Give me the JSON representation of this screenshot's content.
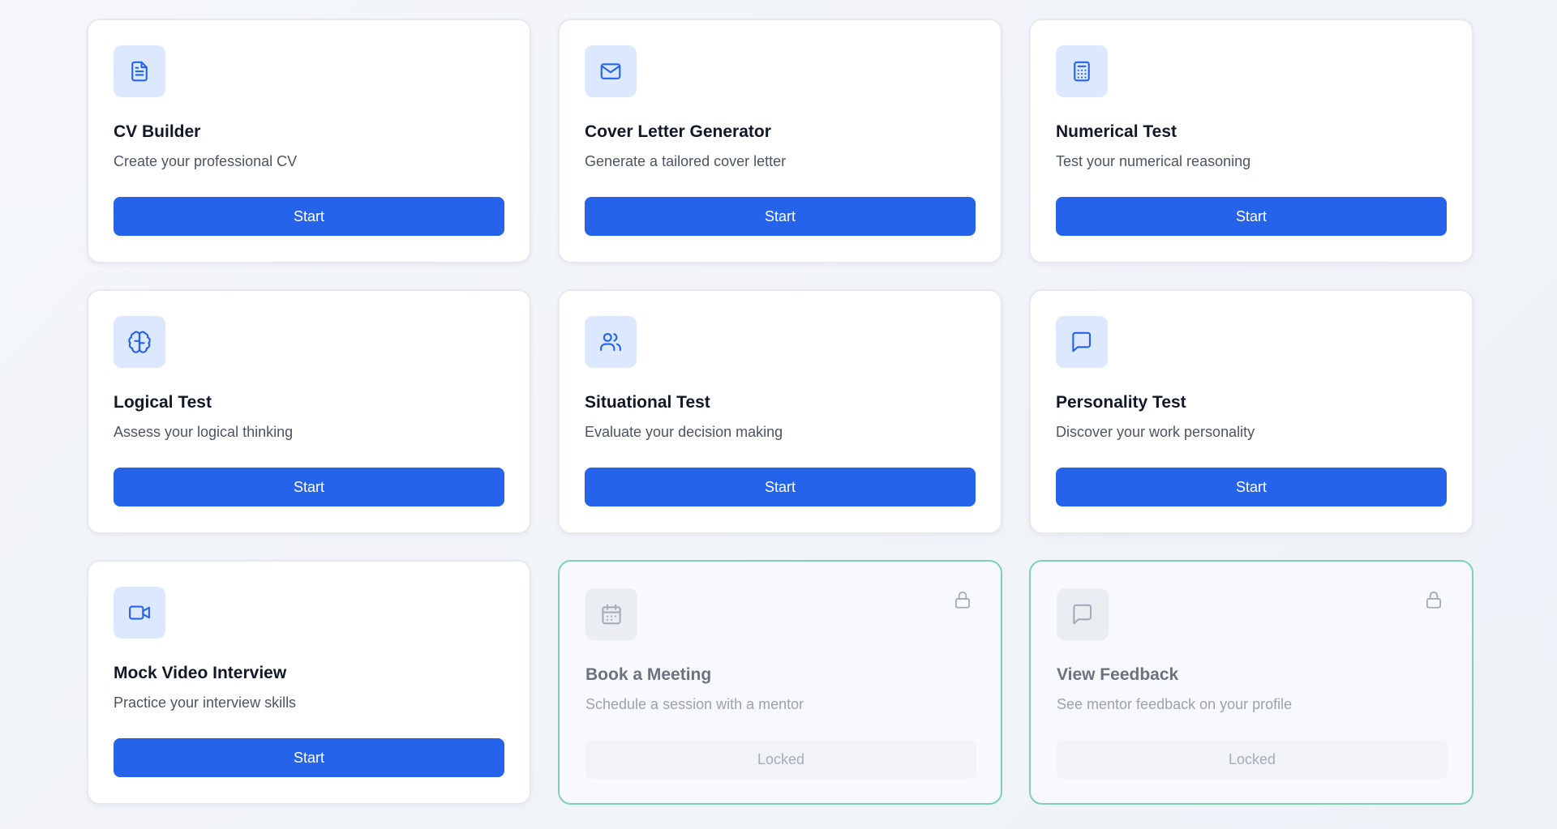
{
  "cards": [
    {
      "title": "CV Builder",
      "subtitle": "Create your professional CV",
      "button": "Start",
      "icon": "document-icon",
      "locked": false
    },
    {
      "title": "Cover Letter Generator",
      "subtitle": "Generate a tailored cover letter",
      "button": "Start",
      "icon": "envelope-icon",
      "locked": false
    },
    {
      "title": "Numerical Test",
      "subtitle": "Test your numerical reasoning",
      "button": "Start",
      "icon": "calculator-icon",
      "locked": false
    },
    {
      "title": "Logical Test",
      "subtitle": "Assess your logical thinking",
      "button": "Start",
      "icon": "brain-icon",
      "locked": false
    },
    {
      "title": "Situational Test",
      "subtitle": "Evaluate your decision making",
      "button": "Start",
      "icon": "users-icon",
      "locked": false
    },
    {
      "title": "Personality Test",
      "subtitle": "Discover your work personality",
      "button": "Start",
      "icon": "chat-icon",
      "locked": false
    },
    {
      "title": "Mock Video Interview",
      "subtitle": "Practice your interview skills",
      "button": "Start",
      "icon": "video-camera-icon",
      "locked": false
    },
    {
      "title": "Book a Meeting",
      "subtitle": "Schedule a session with a mentor",
      "button": "Locked",
      "icon": "calendar-icon",
      "locked": true
    },
    {
      "title": "View Feedback",
      "subtitle": "See mentor feedback on your profile",
      "button": "Locked",
      "icon": "chat-icon",
      "locked": true
    }
  ],
  "colors": {
    "accent": "#2563eb",
    "icon_tile_bg": "#dce8fd",
    "locked_border": "#7fd2b1",
    "title_text": "#111827",
    "muted_text": "#4b5563"
  }
}
